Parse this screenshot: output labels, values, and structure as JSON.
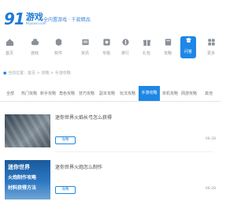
{
  "header": {
    "logo_number": "91",
    "logo_text": "游戏",
    "logo_sub": "91youxi.com",
    "slogan": "全内置游戏 · 千款精品"
  },
  "nav": {
    "items": [
      {
        "label": "首页",
        "icon": "home-icon"
      },
      {
        "label": "游戏",
        "icon": "gamepad-icon"
      },
      {
        "label": "软件",
        "icon": "app-icon"
      },
      {
        "label": "资讯",
        "icon": "news-icon"
      },
      {
        "label": "专题",
        "icon": "topic-icon"
      },
      {
        "label": "排行",
        "icon": "rank-icon"
      },
      {
        "label": "礼包",
        "icon": "gift-icon"
      },
      {
        "label": "攻略",
        "icon": "guide-icon"
      },
      {
        "label": "问答",
        "icon": "qa-icon"
      },
      {
        "label": "更多",
        "icon": "more-icon"
      }
    ]
  },
  "breadcrumb": "当前位置：首页 > 攻略 > 手游攻略",
  "tabs": [
    "全部",
    "热门攻略",
    "新手攻略",
    "角色攻略",
    "技巧攻略",
    "副本攻略",
    "玩法攻略",
    "手游攻略",
    "单机攻略",
    "网游攻略",
    "其他"
  ],
  "articles": [
    {
      "title": "迷你世界火焰长弓怎么获得",
      "tag": "攻略",
      "date": "06-28",
      "thumb_lines": []
    },
    {
      "title": "迷你世界火炮怎么制作",
      "tag": "攻略",
      "date": "06-28",
      "thumb_lines": [
        "迷你世界",
        "火炮制作攻略",
        "材料获得方法"
      ]
    }
  ],
  "colors": {
    "accent": "#1e87e6",
    "brand": "#1f7ad6"
  }
}
